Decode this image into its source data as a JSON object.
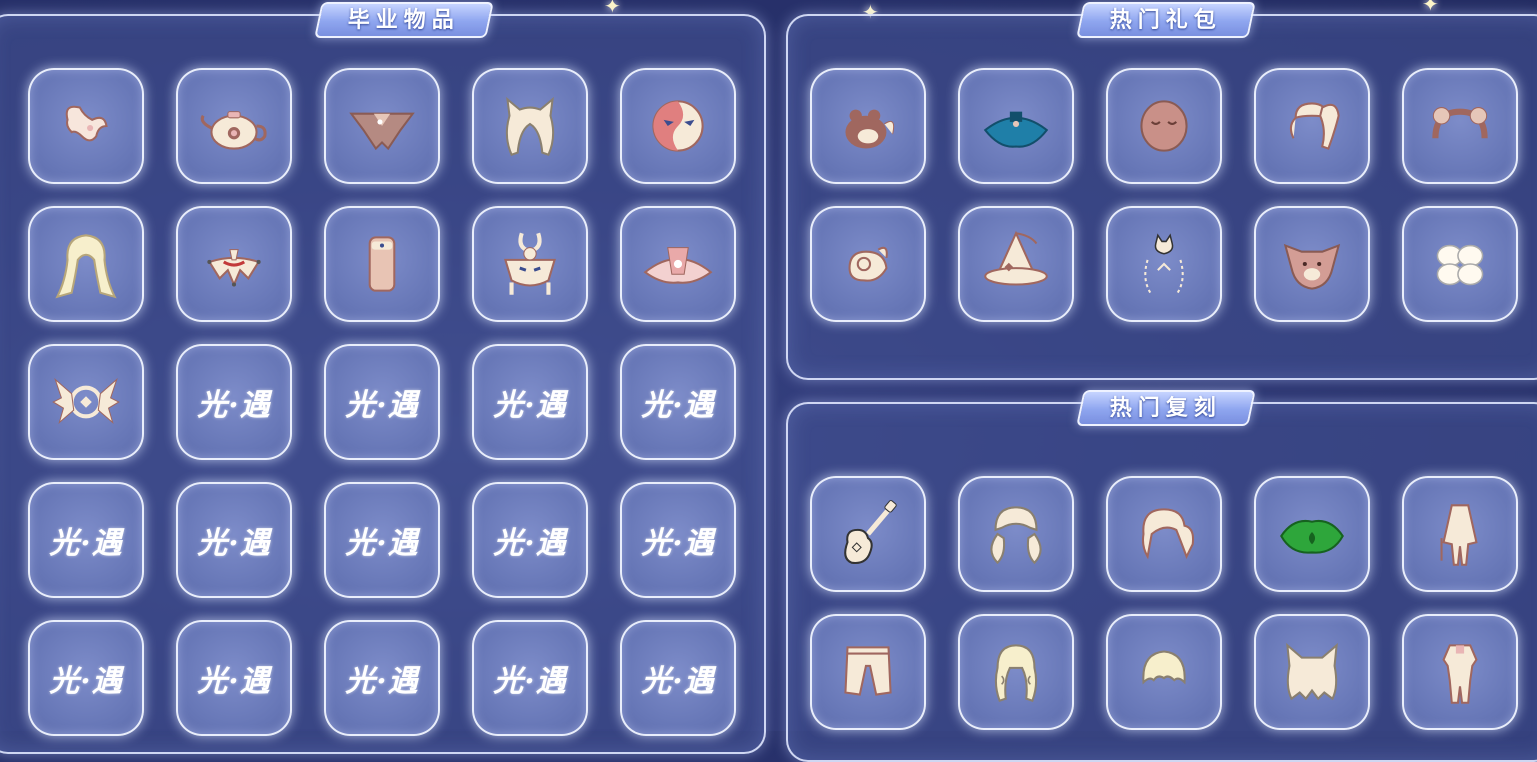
{
  "panels": {
    "graduation": {
      "title": "毕业物品",
      "items": [
        {
          "icon": "hair-ornament-icon"
        },
        {
          "icon": "teapot-icon"
        },
        {
          "icon": "cape-icon"
        },
        {
          "icon": "animal-ear-hair-icon"
        },
        {
          "icon": "mask-icon"
        },
        {
          "icon": "long-hair-icon"
        },
        {
          "icon": "bead-necklace-icon"
        },
        {
          "icon": "scroll-cloak-icon"
        },
        {
          "icon": "antler-mask-icon"
        },
        {
          "icon": "flower-cape-icon"
        },
        {
          "icon": "wing-emblem-icon"
        }
      ],
      "placeholder_count": 14,
      "placeholder_text": "光·遇"
    },
    "gifts": {
      "title": "热门礼包",
      "items": [
        {
          "icon": "bear-pet-icon"
        },
        {
          "icon": "blue-cape-icon"
        },
        {
          "icon": "sleeping-face-mask-icon"
        },
        {
          "icon": "ponytail-hair-icon"
        },
        {
          "icon": "headband-icon"
        },
        {
          "icon": "crab-icon"
        },
        {
          "icon": "witch-hat-icon"
        },
        {
          "icon": "cat-spell-icon"
        },
        {
          "icon": "dog-mask-icon"
        },
        {
          "icon": "flower-icon"
        }
      ]
    },
    "rerun": {
      "title": "热门复刻",
      "items": [
        {
          "icon": "guitar-icon"
        },
        {
          "icon": "twin-tail-hair-icon"
        },
        {
          "icon": "side-ponytail-hair-icon"
        },
        {
          "icon": "green-cape-icon"
        },
        {
          "icon": "outfit-icon"
        },
        {
          "icon": "pants-icon"
        },
        {
          "icon": "curly-hair-icon"
        },
        {
          "icon": "short-hair-icon"
        },
        {
          "icon": "cat-ear-hair-icon"
        },
        {
          "icon": "bodysuit-icon"
        }
      ]
    }
  },
  "colors": {
    "background": "#2b3572",
    "panel_border": "#e1e8ff",
    "slot_fill": "#6676b6",
    "item_cream": "#f6ead8",
    "item_pink": "#e9b5b5",
    "item_brown": "#a0675f",
    "cape_blue": "#1f7fa8",
    "cape_green": "#2ea63b"
  }
}
